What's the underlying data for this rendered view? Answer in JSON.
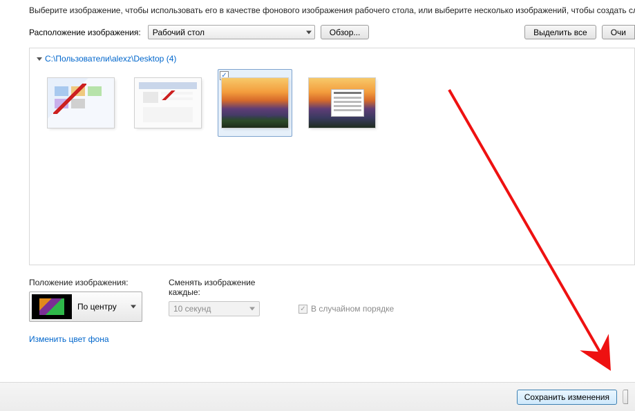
{
  "instruction": "Выберите изображение, чтобы использовать его в качестве фонового изображения рабочего стола, или выберите несколько изображений, чтобы создать сл",
  "location": {
    "label": "Расположение изображения:",
    "value": "Рабочий стол",
    "browse": "Обзор...",
    "select_all": "Выделить все",
    "clear": "Очи"
  },
  "gallery": {
    "path": "C:\\Пользователи\\alexz\\Desktop (4)",
    "selected_index": 2,
    "checked_index": 2,
    "thumbs": [
      {
        "checked": false,
        "selected": false
      },
      {
        "checked": false,
        "selected": false
      },
      {
        "checked": true,
        "selected": true
      },
      {
        "checked": false,
        "selected": false
      }
    ]
  },
  "position": {
    "label": "Положение изображения:",
    "value": "По центру"
  },
  "interval": {
    "label": "Сменять изображение каждые:",
    "value": "10 секунд",
    "disabled": true
  },
  "random": {
    "label": "В случайном порядке",
    "checked": true,
    "disabled": true
  },
  "change_color_link": "Изменить цвет фона",
  "footer": {
    "save": "Сохранить изменения"
  }
}
